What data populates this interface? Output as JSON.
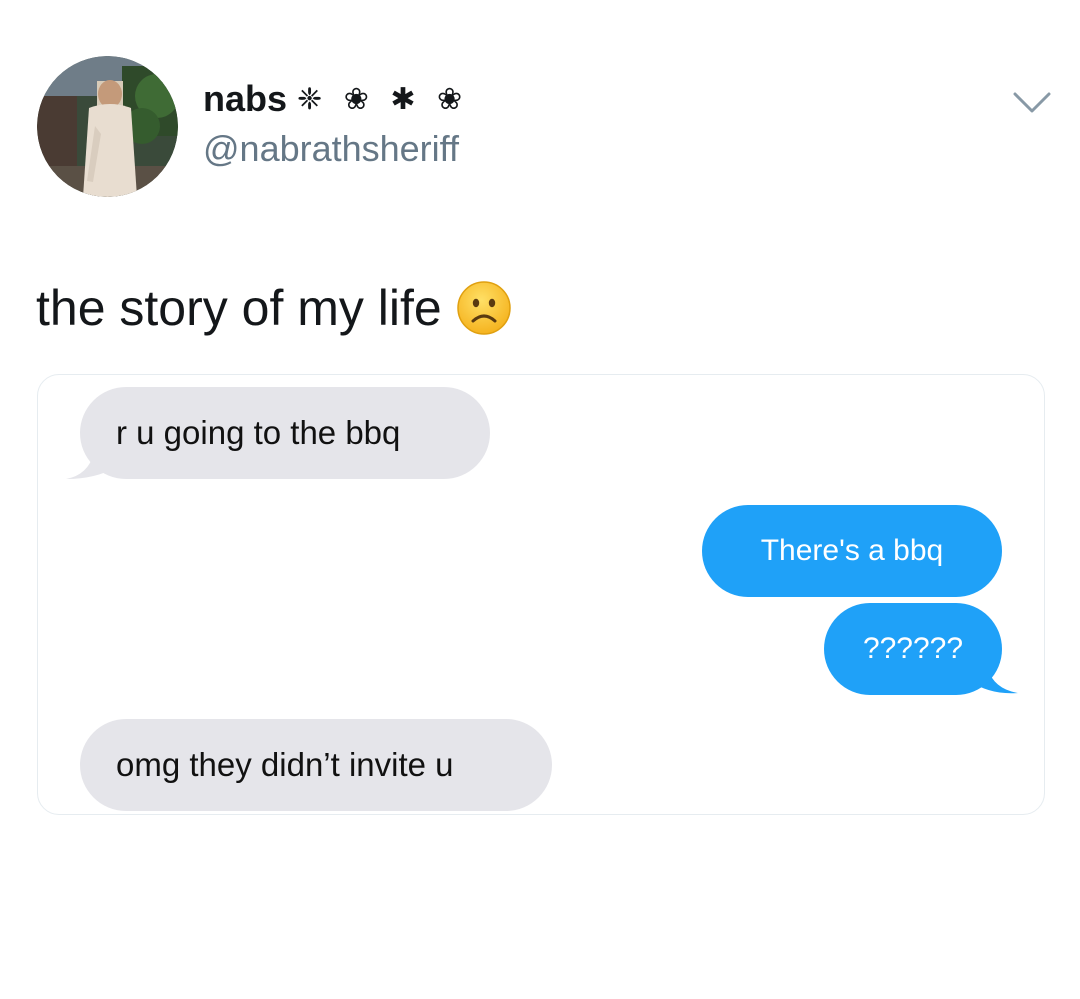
{
  "tweet": {
    "author": {
      "display_name": "nabs",
      "name_decoration": "❈ ❀ ✱ ❀",
      "handle": "@nabrathsheriff",
      "avatar_icon": "profile-photo"
    },
    "text": "the story of my life",
    "emoji_icon": "frowning-face-icon",
    "menu_icon": "chevron-down-icon"
  },
  "chat": {
    "messages": [
      {
        "direction": "received",
        "text": "r u going to the bbq"
      },
      {
        "direction": "sent",
        "text": "There's a bbq"
      },
      {
        "direction": "sent",
        "text": "??????"
      },
      {
        "direction": "received",
        "text": "omg they didn’t invite u"
      }
    ]
  },
  "colors": {
    "handle_gray": "#657786",
    "received_bubble": "#e5e5ea",
    "sent_bubble": "#1fa1f8",
    "emoji_yellow": "#fbc530"
  }
}
